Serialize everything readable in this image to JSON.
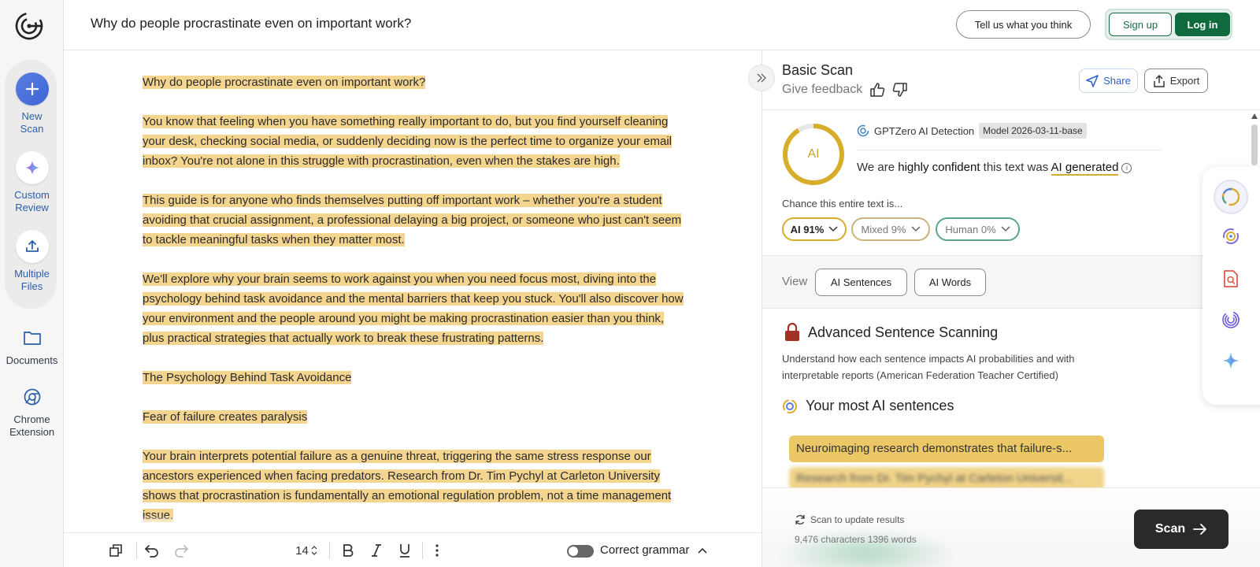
{
  "app": {
    "logo_name": "gptzero-logo"
  },
  "sidebar": {
    "items": [
      {
        "label1": "New",
        "label2": "Scan",
        "icon": "plus-icon"
      },
      {
        "label1": "Custom",
        "label2": "Review",
        "icon": "sparkle-icon"
      },
      {
        "label1": "Multiple",
        "label2": "Files",
        "icon": "upload-icon"
      },
      {
        "label1": "Documents",
        "label2": "",
        "icon": "folder-icon"
      },
      {
        "label1": "Chrome",
        "label2": "Extension",
        "icon": "chrome-icon"
      }
    ]
  },
  "header": {
    "title": "Why do people procrastinate even on important work?",
    "feedback_label": "Tell us what you think",
    "signup_label": "Sign up",
    "login_label": "Log in"
  },
  "editor": {
    "paragraphs": [
      "Why do people procrastinate even on important work?",
      "You know that feeling when you have something really important to do, but you find yourself cleaning your desk, checking social media, or suddenly deciding now is the perfect time to organize your email inbox? You're not alone in this struggle with procrastination, even when the stakes are high.",
      "This guide is for anyone who finds themselves putting off important work – whether you're a student avoiding that crucial assignment, a professional delaying a big project, or someone who just can't seem to tackle meaningful tasks when they matter most.",
      "We'll explore why your brain seems to work against you when you need focus most, diving into the psychology behind task avoidance and the mental barriers that keep you stuck. You'll also discover how your environment and the people around you might be making procrastination easier than you think, plus practical strategies that actually work to break these frustrating patterns.",
      "The Psychology Behind Task Avoidance",
      "Fear of failure creates paralysis",
      "Your brain interprets potential failure as a genuine threat, triggering the same stress response our ancestors experienced when facing predators. Research from Dr. Tim Pychyl at Carleton University shows that procrastination is fundamentally an emotional regulation problem, not a time management issue."
    ]
  },
  "toolbar": {
    "font_size": "14",
    "grammar_label": "Correct grammar"
  },
  "panel": {
    "title": "Basic Scan",
    "give_feedback": "Give feedback",
    "share_label": "Share",
    "export_label": "Export",
    "ring_label": "AI",
    "ai_fraction": 0.91,
    "detector_name": "GPTZero AI Detection",
    "model_badge": "Model 2026-03-11-base",
    "confidence_pre": "We are ",
    "confidence_strong": "highly confident",
    "confidence_mid": " this text was ",
    "confidence_result": "AI generated",
    "chance_label": "Chance this entire text is...",
    "pills": {
      "ai": "AI 91%",
      "mixed": "Mixed 9%",
      "human": "Human 0%"
    },
    "view_label": "View",
    "view_ai_sentences": "AI Sentences",
    "view_ai_words": "AI Words",
    "adv_title": "Advanced Sentence Scanning",
    "adv_desc": "Understand how each sentence impacts AI probabilities and with interpretable reports (American Federation Teacher Certified)",
    "most_title": "Your most AI sentences",
    "sentence_1": "Neuroimaging research demonstrates that failure-s...",
    "sentence_2": "Research from Dr. Tim Pychyl at Carleton Universit...",
    "scan_update": "Scan to update results",
    "counts": "9,476 characters 1396 words",
    "scan_label": "Scan"
  },
  "colors": {
    "ai": "#d9ad2c",
    "highlight": "#f4d590",
    "login": "#0f6a3e",
    "human": "#5aa58a"
  }
}
